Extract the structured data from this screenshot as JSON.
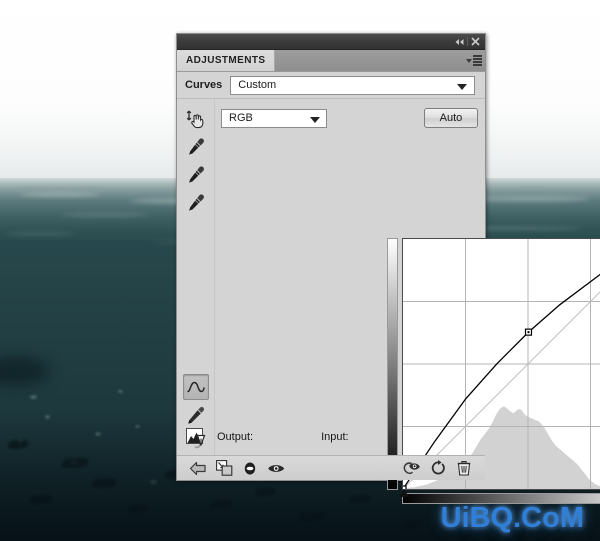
{
  "background": {
    "description": "underwater ocean photo with horizon, whale shark silhouette"
  },
  "watermark": {
    "text": "UiBQ.CoM",
    "color": "#2f7fd8"
  },
  "panel": {
    "titlebar": {
      "collapse_icon": "double-chevron-left-icon",
      "collapse_glyph": "◀◀",
      "close_icon": "close-icon",
      "close_glyph": "✕"
    },
    "tabs": [
      {
        "label": "ADJUSTMENTS",
        "active": true
      }
    ],
    "menu_icon": "panel-menu-icon",
    "header": {
      "title": "Curves",
      "preset_value": "Custom",
      "preset_caret_icon": "chevron-down-icon"
    },
    "toolbar": {
      "channel_value": "RGB",
      "channel_caret_icon": "chevron-down-icon",
      "auto_label": "Auto"
    },
    "tools": [
      {
        "name": "on-image-adjust-tool",
        "icon": "hand-arrows-icon",
        "selected": false
      },
      {
        "name": "black-point-eyedropper",
        "icon": "eyedropper-icon",
        "selected": false
      },
      {
        "name": "gray-point-eyedropper",
        "icon": "eyedropper-icon",
        "selected": false
      },
      {
        "name": "white-point-eyedropper",
        "icon": "eyedropper-icon",
        "selected": false
      },
      {
        "name": "curve-tool",
        "icon": "curve-icon",
        "selected": true
      },
      {
        "name": "pencil-tool",
        "icon": "pencil-icon",
        "selected": false
      },
      {
        "name": "smooth-tool",
        "icon": "smooth-s-icon",
        "selected": false
      }
    ],
    "io": {
      "histogram_warning_icon": "histogram-warning-icon",
      "output_label": "Output:",
      "output_value": "",
      "input_label": "Input:",
      "input_value": ""
    },
    "footer": {
      "left_buttons": [
        {
          "name": "return-to-adjustment-list-button",
          "icon": "back-arrow-icon"
        },
        {
          "name": "clip-to-layer-button",
          "icon": "clip-to-layer-icon"
        },
        {
          "name": "toggle-layer-visibility-button",
          "icon": "half-circle-icon"
        },
        {
          "name": "preview-toggle-button",
          "icon": "eye-icon"
        }
      ],
      "right_buttons": [
        {
          "name": "view-previous-state-button",
          "icon": "eye-swirl-icon"
        },
        {
          "name": "reset-button",
          "icon": "reset-circular-arrow-icon"
        },
        {
          "name": "delete-adjustment-button",
          "icon": "trash-icon"
        }
      ]
    }
  },
  "chart_data": {
    "type": "line",
    "title": "Curves (RGB)",
    "xlabel": "Input",
    "ylabel": "Output",
    "xlim": [
      0,
      255
    ],
    "ylim": [
      0,
      255
    ],
    "grid": true,
    "grid_divisions": 4,
    "legend": "none",
    "series": [
      {
        "name": "baseline-diagonal",
        "color": "#c0c0c0",
        "points": [
          [
            0,
            0
          ],
          [
            255,
            255
          ]
        ]
      },
      {
        "name": "tone-curve",
        "color": "#000000",
        "points": [
          [
            0,
            0
          ],
          [
            32,
            48
          ],
          [
            64,
            92
          ],
          [
            96,
            128
          ],
          [
            128,
            160
          ],
          [
            160,
            188
          ],
          [
            192,
            212
          ],
          [
            224,
            236
          ],
          [
            255,
            255
          ]
        ]
      }
    ],
    "control_points": [
      {
        "input": 0,
        "output": 0,
        "selected": false
      },
      {
        "input": 128,
        "output": 160,
        "selected": true
      },
      {
        "input": 255,
        "output": 255,
        "selected": false
      }
    ],
    "histogram": {
      "name": "image-histogram",
      "color": "#d2d2d2",
      "bins": [
        1,
        1,
        1,
        1,
        2,
        2,
        2,
        3,
        3,
        4,
        4,
        5,
        5,
        6,
        7,
        8,
        9,
        10,
        11,
        13,
        14,
        16,
        18,
        20,
        23,
        26,
        28,
        30,
        31,
        32,
        32,
        33,
        34,
        36,
        38,
        41,
        44,
        48,
        52,
        56,
        60,
        63,
        66,
        69,
        72,
        76,
        80,
        85,
        90,
        94,
        97,
        99,
        100,
        99,
        97,
        95,
        93,
        92,
        94,
        96,
        97,
        96,
        93,
        90,
        88,
        87,
        86,
        85,
        84,
        83,
        82,
        80,
        77,
        74,
        70,
        66,
        62,
        58,
        55,
        52,
        50,
        48,
        46,
        44,
        42,
        40,
        38,
        36,
        34,
        32,
        30,
        27,
        24,
        21,
        18,
        15,
        12,
        10,
        8,
        6,
        5,
        4,
        3,
        3,
        2,
        2,
        2,
        1,
        1,
        1,
        1,
        1,
        1,
        1,
        1,
        1,
        1,
        1,
        1,
        1,
        1,
        1,
        1,
        1,
        1,
        1,
        1,
        1,
        1,
        1
      ]
    },
    "gradient_bars": {
      "vertical": {
        "name": "output-gradient-bar",
        "from": "#ffffff",
        "to": "#000000"
      },
      "horizontal": {
        "name": "input-gradient-bar",
        "from": "#000000",
        "to": "#ffffff"
      }
    },
    "markers": [
      {
        "name": "black-point-marker",
        "position": 0,
        "fill": "#111111"
      },
      {
        "name": "white-point-marker",
        "position": 255,
        "fill": "#ffffff"
      }
    ]
  }
}
